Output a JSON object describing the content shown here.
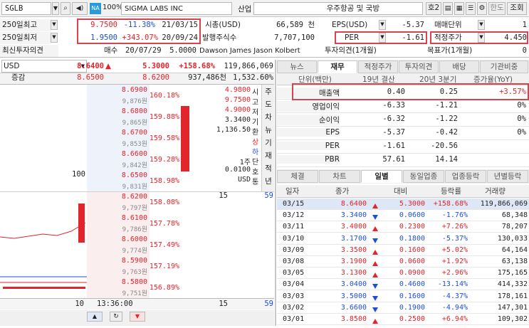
{
  "toolbar": {
    "ticker": "SGLB",
    "na_badge": "NA",
    "zoom": "100%",
    "company": "SIGMA LABS INC",
    "sector_label": "산업",
    "sector_value": "우주항공 및 국방",
    "btn_ho2": "호2",
    "btn_hando": "한도",
    "btn_lookup": "조회"
  },
  "info": {
    "hi250_label": "250일최고",
    "hi250_price": "9.7500",
    "hi250_pct": "-11.38%",
    "hi250_date": "21/03/15",
    "lo250_label": "250일최저",
    "lo250_price": "1.9500",
    "lo250_pct": "+343.07%",
    "lo250_date": "20/09/24",
    "mktcap_label": "시총(USD)",
    "mktcap_value": "66,589 천",
    "shares_label": "발행주식수",
    "shares_value": "7,707,100",
    "eps_label": "EPS(USD)",
    "eps_value": "-5.37",
    "per_label": "PER",
    "per_value": "-1.61",
    "lot_label": "매매단위",
    "lot_value": "1",
    "target_label": "적정주가",
    "target_value": "4.450",
    "opinion_label": "최신투자의견",
    "opinion_action": "매수",
    "opinion_date": "20/07/29",
    "opinion_price": "5.0000",
    "opinion_broker": "Dawson James Jason Kolbert",
    "op1m_label": "투자의견(1개월)",
    "op1m_value": "",
    "tp1m_label": "목표가(1개월)",
    "tp1m_value": "0"
  },
  "quote": {
    "currency": "USD",
    "price": "8.6400",
    "change": "5.3000",
    "change_pct": "+158.68%",
    "volume": "119,866,069",
    "margin_label": "증감",
    "margin_low": "8.6500",
    "margin_high": "8.6200",
    "vol2": "937,486천",
    "ratio": "1,532.60%"
  },
  "orderbook": {
    "asks": [
      {
        "price": "8.6900",
        "krw": "9,876원",
        "pct": "160.18%"
      },
      {
        "price": "8.6800",
        "krw": "9,865원",
        "pct": "159.88%"
      },
      {
        "price": "8.6700",
        "krw": "9,853원",
        "pct": "159.58%"
      },
      {
        "price": "8.6600",
        "krw": "9,842원",
        "pct": "159.28%"
      },
      {
        "price": "8.6500",
        "krw": "9,831원",
        "pct": "158.98%",
        "qty": "100"
      }
    ],
    "bids": [
      {
        "price": "8.6200",
        "krw": "9,797원",
        "pct": "158.08%",
        "qty": "15"
      },
      {
        "price": "8.6100",
        "krw": "9,786원",
        "pct": "157.78%"
      },
      {
        "price": "8.6000",
        "krw": "9,774원",
        "pct": "157.49%"
      },
      {
        "price": "8.5900",
        "krw": "9,763원",
        "pct": "157.19%"
      },
      {
        "price": "8.5800",
        "krw": "9,751원",
        "pct": "156.89%"
      }
    ],
    "summary": {
      "open_label": "시",
      "open": "4.9800",
      "high_label": "고",
      "high": "9.7500",
      "low_label": "저",
      "low": "4.9000",
      "base_label": "기",
      "base": "3.3400",
      "fx_label": "환",
      "fx": "1,136.50",
      "up_label": "상",
      "down_label": "하",
      "unit_label1": "단",
      "unit1": "1주",
      "unit_label2": "호",
      "unit2": "0.0100",
      "cur_label": "통",
      "cur": "USD"
    },
    "side_tabs": [
      "주",
      "도",
      "차",
      "뉴",
      "기",
      "재",
      "적",
      "년"
    ],
    "bid_total_right": "59",
    "bid_vol_mid": "15",
    "footer_left": "10",
    "footer_time": "13:36:00",
    "footer_right": "15",
    "footer_right2": "59"
  },
  "top_tabs": [
    "뉴스",
    "재무",
    "적정주가",
    "투자의견",
    "배당",
    "기관비중"
  ],
  "financials": {
    "header": [
      "단위(백만)",
      "19년 결산",
      "20년 3분기",
      "증가율(YoY)"
    ],
    "rows": [
      {
        "label": "매출액",
        "v1": "0.40",
        "v2": "0.25",
        "v3": "+3.57%"
      },
      {
        "label": "영업이익",
        "v1": "-6.33",
        "v2": "-1.21",
        "v3": "0%"
      },
      {
        "label": "순이익",
        "v1": "-6.32",
        "v2": "-1.22",
        "v3": "0%"
      },
      {
        "label": "EPS",
        "v1": "-5.37",
        "v2": "-0.42",
        "v3": "0%"
      },
      {
        "label": "PER",
        "v1": "-1.61",
        "v2": "-20.56",
        "v3": ""
      },
      {
        "label": "PBR",
        "v1": "57.61",
        "v2": "14.14",
        "v3": ""
      }
    ]
  },
  "bottom_tabs": [
    "체결",
    "차트",
    "일별",
    "동일업종",
    "업종등락",
    "년별등락"
  ],
  "daily": {
    "header": [
      "일자",
      "종가",
      "대비",
      "등락률",
      "거래량"
    ],
    "rows": [
      {
        "date": "03/15",
        "close": "8.6400",
        "dir": "up",
        "diff": "5.3000",
        "pct": "+158.68%",
        "vol": "119,866,069"
      },
      {
        "date": "03/12",
        "close": "3.3400",
        "dir": "down",
        "diff": "0.0600",
        "pct": "-1.76%",
        "vol": "68,348"
      },
      {
        "date": "03/11",
        "close": "3.4000",
        "dir": "up",
        "diff": "0.2300",
        "pct": "+7.26%",
        "vol": "78,207"
      },
      {
        "date": "03/10",
        "close": "3.1700",
        "dir": "down",
        "diff": "0.1800",
        "pct": "-5.37%",
        "vol": "130,033"
      },
      {
        "date": "03/09",
        "close": "3.3500",
        "dir": "up",
        "diff": "0.1600",
        "pct": "+5.02%",
        "vol": "64,164"
      },
      {
        "date": "03/08",
        "close": "3.1900",
        "dir": "up",
        "diff": "0.0600",
        "pct": "+1.92%",
        "vol": "63,138"
      },
      {
        "date": "03/05",
        "close": "3.1300",
        "dir": "up",
        "diff": "0.0900",
        "pct": "+2.96%",
        "vol": "175,165"
      },
      {
        "date": "03/04",
        "close": "3.0400",
        "dir": "down",
        "diff": "0.4600",
        "pct": "-13.14%",
        "vol": "414,332"
      },
      {
        "date": "03/03",
        "close": "3.5000",
        "dir": "down",
        "diff": "0.1600",
        "pct": "-4.37%",
        "vol": "178,161"
      },
      {
        "date": "03/02",
        "close": "3.6600",
        "dir": "down",
        "diff": "0.1900",
        "pct": "-4.94%",
        "vol": "147,301"
      },
      {
        "date": "03/01",
        "close": "3.8500",
        "dir": "up",
        "diff": "0.2500",
        "pct": "+6.94%",
        "vol": "109,302"
      }
    ]
  },
  "colors": {
    "up": "#e2242c",
    "down": "#1f4fd8",
    "highlight": "#d9434e"
  }
}
